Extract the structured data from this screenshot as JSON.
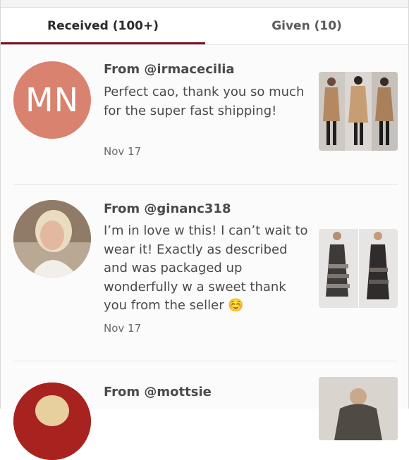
{
  "tabs": {
    "received": "Received (100+)",
    "given": "Given (10)"
  },
  "reviews": [
    {
      "from": "From @irmacecilia",
      "initials": "MN",
      "text": "Perfect cao, thank you so much for the super fast shipping!",
      "date": "Nov 17"
    },
    {
      "from": "From @ginanc318",
      "text": "I’m in love w this! I can’t wait to wear it! Exactly as described and was packaged up wonderfully w a sweet thank you from the seller ☺️",
      "date": "Nov 17"
    },
    {
      "from": "From @mottsie"
    }
  ],
  "colors": {
    "accent": "#7f0f1f",
    "avatar_bg": "#d98270"
  }
}
